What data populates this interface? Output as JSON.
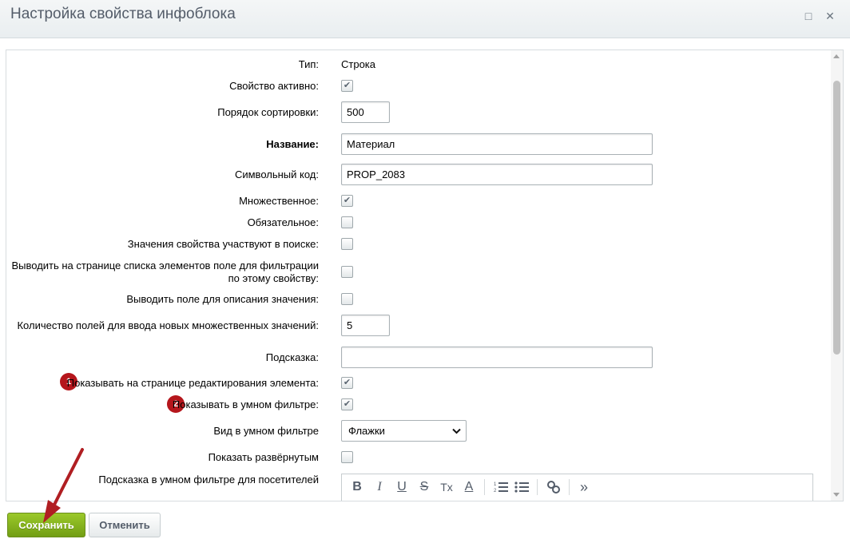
{
  "window": {
    "title": "Настройка свойства инфоблока",
    "maximize_icon": "□",
    "close_icon": "✕"
  },
  "form": {
    "type_label": "Тип:",
    "type_value": "Строка",
    "active_label": "Свойство активно:",
    "active_checked": true,
    "sort_label": "Порядок сортировки:",
    "sort_value": "500",
    "name_label": "Название:",
    "name_value": "Материал",
    "code_label": "Символьный код:",
    "code_value": "PROP_2083",
    "multiple_label": "Множественное:",
    "multiple_checked": true,
    "required_label": "Обязательное:",
    "required_checked": false,
    "search_label": "Значения свойства участвуют в поиске:",
    "search_checked": false,
    "filter_list_label_1": "Выводить на странице списка элементов поле для фильтрации",
    "filter_list_label_2": "по этому свойству:",
    "filter_list_checked": false,
    "description_label": "Выводить поле для описания значения:",
    "description_checked": false,
    "multiple_count_label": "Количество полей для ввода новых множественных значений:",
    "multiple_count_value": "5",
    "hint_label": "Подсказка:",
    "hint_value": "",
    "show_edit_label": "Показывать на странице редактирования элемента:",
    "show_edit_checked": true,
    "show_edit_badge": "1",
    "show_smart_label": "Показывать в умном фильтре:",
    "show_smart_checked": true,
    "show_smart_badge": "2",
    "smart_view_label": "Вид в умном фильтре",
    "smart_view_value": "Флажки",
    "expanded_label": "Показать развёрнутым",
    "expanded_checked": false,
    "smart_hint_label": "Подсказка в умном фильтре для посетителей"
  },
  "editor_toolbar": [
    "B",
    "I",
    "U",
    "S",
    "Tx",
    "A",
    "ordered-list",
    "bullet-list",
    "link",
    "more"
  ],
  "buttons": {
    "save": "Сохранить",
    "cancel": "Отменить"
  },
  "colors": {
    "save_button": "#8cbf26",
    "badge": "#b5161c",
    "annotation_arrow": "#b01e22"
  }
}
